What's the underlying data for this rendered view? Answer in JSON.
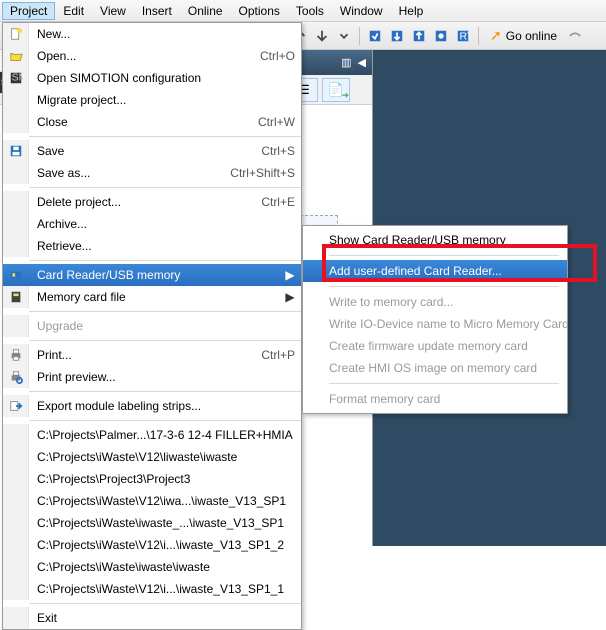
{
  "menubar": {
    "items": [
      "Project",
      "Edit",
      "View",
      "Insert",
      "Online",
      "Options",
      "Tools",
      "Window",
      "Help"
    ],
    "active_index": 0
  },
  "toolbar": {
    "go_online": "Go online"
  },
  "dropdown": {
    "items": [
      {
        "icon": "new",
        "label": "New...",
        "shortcut": ""
      },
      {
        "icon": "open",
        "label": "Open...",
        "shortcut": "Ctrl+O"
      },
      {
        "icon": "simotion",
        "label": "Open SIMOTION configuration",
        "shortcut": ""
      },
      {
        "icon": "",
        "label": "Migrate project...",
        "shortcut": ""
      },
      {
        "icon": "",
        "label": "Close",
        "shortcut": "Ctrl+W"
      },
      {
        "sep": true
      },
      {
        "icon": "save",
        "label": "Save",
        "shortcut": "Ctrl+S"
      },
      {
        "icon": "",
        "label": "Save as...",
        "shortcut": "Ctrl+Shift+S"
      },
      {
        "sep": true
      },
      {
        "icon": "",
        "label": "Delete project...",
        "shortcut": "Ctrl+E"
      },
      {
        "icon": "",
        "label": "Archive...",
        "shortcut": ""
      },
      {
        "icon": "",
        "label": "Retrieve...",
        "shortcut": ""
      },
      {
        "sep": true
      },
      {
        "icon": "card",
        "label": "Card Reader/USB memory",
        "shortcut": "",
        "submenu": true,
        "highlighted": true
      },
      {
        "icon": "memcard",
        "label": "Memory card file",
        "shortcut": "",
        "submenu": true
      },
      {
        "sep": true
      },
      {
        "icon": "",
        "label": "Upgrade",
        "shortcut": "",
        "disabled": true
      },
      {
        "sep": true
      },
      {
        "icon": "print",
        "label": "Print...",
        "shortcut": "Ctrl+P"
      },
      {
        "icon": "printprev",
        "label": "Print preview...",
        "shortcut": ""
      },
      {
        "sep": true
      },
      {
        "icon": "export",
        "label": "Export module labeling strips...",
        "shortcut": ""
      },
      {
        "sep": true
      },
      {
        "icon": "",
        "label": "C:\\Projects\\Palmer...\\17-3-6 12-4 FILLER+HMIA",
        "shortcut": ""
      },
      {
        "icon": "",
        "label": "C:\\Projects\\iWaste\\V12\\liwaste\\iwaste",
        "shortcut": ""
      },
      {
        "icon": "",
        "label": "C:\\Projects\\Project3\\Project3",
        "shortcut": ""
      },
      {
        "icon": "",
        "label": "C:\\Projects\\iWaste\\V12\\iwa...\\iwaste_V13_SP1",
        "shortcut": ""
      },
      {
        "icon": "",
        "label": "C:\\Projects\\iWaste\\iwaste_...\\iwaste_V13_SP1",
        "shortcut": ""
      },
      {
        "icon": "",
        "label": "C:\\Projects\\iWaste\\V12\\i...\\iwaste_V13_SP1_2",
        "shortcut": ""
      },
      {
        "icon": "",
        "label": "C:\\Projects\\iWaste\\iwaste\\iwaste",
        "shortcut": ""
      },
      {
        "icon": "",
        "label": "C:\\Projects\\iWaste\\V12\\i...\\iwaste_V13_SP1_1",
        "shortcut": ""
      },
      {
        "sep": true
      },
      {
        "icon": "",
        "label": "Exit",
        "shortcut": ""
      }
    ]
  },
  "submenu": {
    "items": [
      {
        "label": "Show Card Reader/USB memory"
      },
      {
        "sep": true
      },
      {
        "label": "Add user-defined Card Reader...",
        "highlighted": true
      },
      {
        "sep": true
      },
      {
        "label": "Write to memory card...",
        "disabled": true
      },
      {
        "label": "Write IO-Device name to Micro Memory Card",
        "disabled": true
      },
      {
        "label": "Create firmware update memory card",
        "disabled": true
      },
      {
        "label": "Create HMI OS image on memory card",
        "disabled": true
      },
      {
        "sep": true
      },
      {
        "label": "Format memory card",
        "disabled": true
      }
    ]
  }
}
